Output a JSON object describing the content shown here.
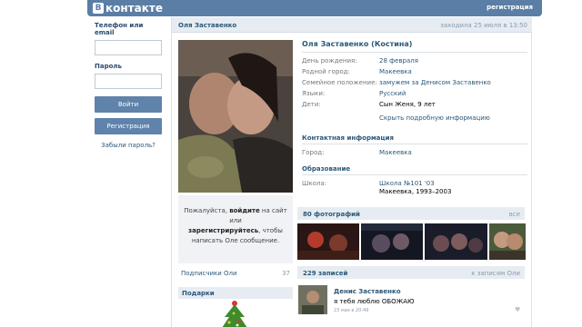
{
  "brand": {
    "logo_text": "контакте",
    "logo_glyph": "В"
  },
  "header": {
    "register_link": "регистрация"
  },
  "login": {
    "phone_label": "Телефон или email",
    "phone_value": "",
    "password_label": "Пароль",
    "password_value": "",
    "login_button": "Войти",
    "register_button": "Регистрация",
    "forgot_link": "Забыли пароль?"
  },
  "profile_header": {
    "name": "Оля Заставенко",
    "last_seen": "заходила 25 июля в 13:50"
  },
  "profile": {
    "full_name": "Оля Заставенко (Костина)",
    "fields": [
      {
        "label": "День рождения:",
        "value": "28 февраля"
      },
      {
        "label": "Родной город:",
        "value": "Макеевка"
      },
      {
        "label": "Семейное положение:",
        "value": "замужем за Денисом Заставенко"
      },
      {
        "label": "Языки:",
        "value": "Русский"
      },
      {
        "label": "Дети:",
        "value": "Сын Женя, 9 лет"
      }
    ],
    "hide_link": "Скрыть подробную информацию",
    "contact_section": "Контактная информация",
    "city_label": "Город:",
    "city_value": "Макеевка",
    "education_section": "Образование",
    "school_label": "Школа:",
    "school_value": "Школа №101 '03",
    "school_value2": "Макеевка, 1993–2003"
  },
  "notice": {
    "line1_prefix": "Пожалуйста, ",
    "login_word": "войдите",
    "line1_suffix": " на сайт или",
    "register_word": "зарегистрируйтесь",
    "line2_suffix": ", чтобы",
    "line3": "написать Оле сообщение."
  },
  "subscribers": {
    "label": "Подписчики Оли",
    "count": "37"
  },
  "gifts": {
    "title": "Подарки"
  },
  "photos": {
    "title": "80 фотографий",
    "all_link": "все"
  },
  "wall": {
    "title": "229 записей",
    "to_link": "к записям Оли",
    "post": {
      "author": "Денис Заставенко",
      "text": "я тебя люблю ОБОЖАЮ",
      "date": "23 мая в 20:49"
    }
  },
  "colors": {
    "header_bg": "#5b7ea6",
    "link": "#2b587a",
    "button": "#5f83ab"
  },
  "icons": {
    "heart": "heart-icon",
    "gift": "christmas-tree-icon"
  }
}
